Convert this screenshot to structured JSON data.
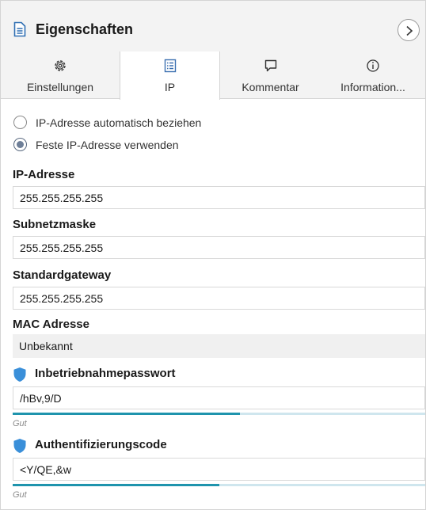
{
  "header": {
    "title": "Eigenschaften",
    "icon": "document-icon",
    "collapse_icon": "chevron-right-icon"
  },
  "tabs": [
    {
      "label": "Einstellungen",
      "icon": "gear-icon",
      "active": false
    },
    {
      "label": "IP",
      "icon": "list-icon",
      "active": true
    },
    {
      "label": "Kommentar",
      "icon": "comment-icon",
      "active": false
    },
    {
      "label": "Information...",
      "icon": "info-icon",
      "active": false
    }
  ],
  "ip_mode": {
    "options": [
      {
        "label": "IP-Adresse automatisch beziehen",
        "checked": false
      },
      {
        "label": "Feste IP-Adresse verwenden",
        "checked": true
      }
    ]
  },
  "fields": {
    "ip_address": {
      "label": "IP-Adresse",
      "value": "255.255.255.255"
    },
    "subnet_mask": {
      "label": "Subnetzmaske",
      "value": "255.255.255.255"
    },
    "gateway": {
      "label": "Standardgateway",
      "value": "255.255.255.255"
    },
    "mac": {
      "label": "MAC Adresse",
      "value": "Unbekannt"
    }
  },
  "commissioning_password": {
    "label": "Inbetriebnahmepasswort",
    "value": "/hBv,9/D",
    "strength_text": "Gut",
    "strength_fraction": 0.55
  },
  "auth_code": {
    "label": "Authentifizierungscode",
    "value": "<Y/QE,&w",
    "strength_text": "Gut",
    "strength_fraction": 0.5
  },
  "colors": {
    "accent": "#1f94ad",
    "track": "#cfe6ee",
    "shield": "#3a8fd9",
    "tab_icon": "#3a6fb0"
  }
}
